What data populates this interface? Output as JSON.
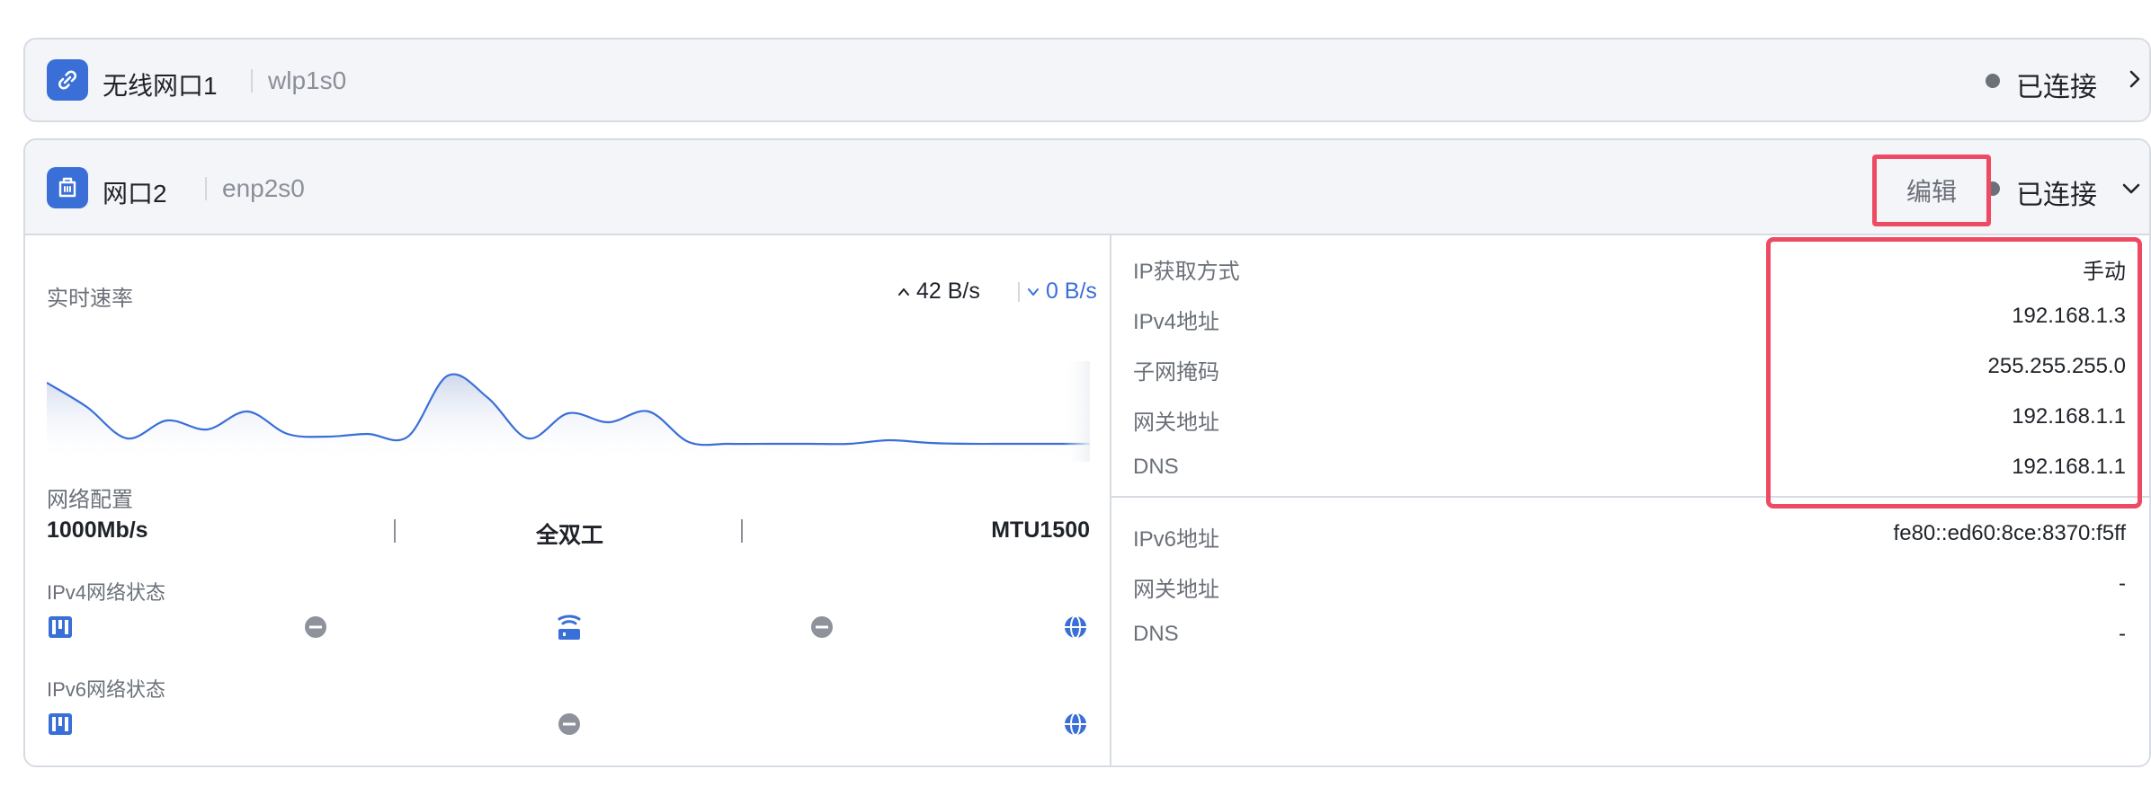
{
  "interfaces": [
    {
      "name": "无线网口1",
      "device": "wlp1s0",
      "status": "已连接",
      "icon": "link-icon"
    },
    {
      "name": "网口2",
      "device": "enp2s0",
      "status": "已连接",
      "icon": "ethernet-port-icon",
      "edit_label": "编辑"
    }
  ],
  "left": {
    "realtime_label": "实时速率",
    "upload": "42 B/s",
    "download": "0 B/s",
    "config_label": "网络配置",
    "speed": "1000Mb/s",
    "duplex": "全双工",
    "mtu": "MTU1500",
    "ipv4_status_label": "IPv4网络状态",
    "ipv6_status_label": "IPv6网络状态"
  },
  "chart_data": {
    "type": "area",
    "series": [
      {
        "values": [
          0.82,
          0.55,
          0.2,
          0.4,
          0.3,
          0.5,
          0.25,
          0.22,
          0.25,
          0.22,
          0.9,
          0.65,
          0.2,
          0.48,
          0.38,
          0.5,
          0.16,
          0.14,
          0.14,
          0.14,
          0.14,
          0.18,
          0.15,
          0.14,
          0.14,
          0.14,
          0.14
        ]
      }
    ]
  },
  "right": {
    "ipv4": [
      {
        "key": "IP获取方式",
        "value": "手动"
      },
      {
        "key": "IPv4地址",
        "value": "192.168.1.3"
      },
      {
        "key": "子网掩码",
        "value": "255.255.255.0"
      },
      {
        "key": "网关地址",
        "value": "192.168.1.1"
      },
      {
        "key": "DNS",
        "value": "192.168.1.1"
      }
    ],
    "ipv6": [
      {
        "key": "IPv6地址",
        "value": "fe80::ed60:8ce:8370:f5ff"
      },
      {
        "key": "网关地址",
        "value": "-"
      },
      {
        "key": "DNS",
        "value": "-"
      }
    ]
  },
  "colors": {
    "accent": "#3a6fd8",
    "highlight": "#ee4a63",
    "status_dot": "#6b7079"
  }
}
